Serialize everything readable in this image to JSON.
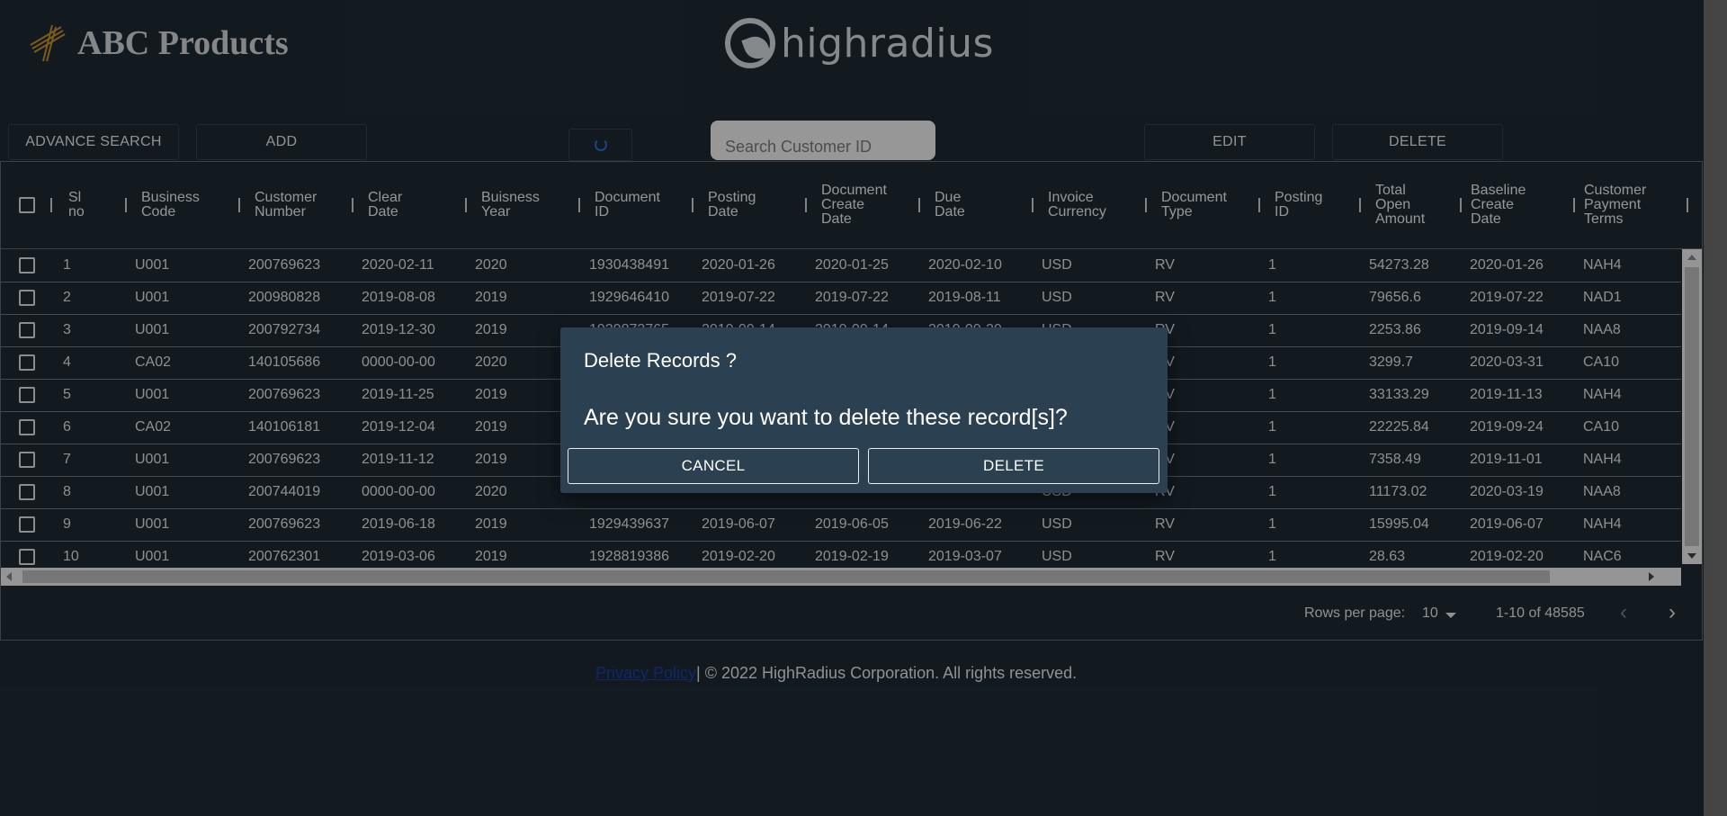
{
  "header": {
    "brand_name": "ABC Products",
    "company_logo_text": "highradius"
  },
  "toolbar": {
    "advance_search": "ADVANCE SEARCH",
    "add": "ADD",
    "refresh_icon": "refresh-icon",
    "search_placeholder": "Search Customer ID",
    "edit": "EDIT",
    "delete": "DELETE"
  },
  "table": {
    "columns": [
      "Sl\nno",
      "Business\nCode",
      "Customer\nNumber",
      "Clear\nDate",
      "Buisness\nYear",
      "Document\nID",
      "Posting\nDate",
      "Document\nCreate\nDate",
      "Due\nDate",
      "Invoice\nCurrency",
      "Document\nType",
      "Posting\nID",
      "Total\nOpen\nAmount",
      "Baseline\nCreate\nDate",
      "Customer\nPayment\nTerms"
    ],
    "rows": [
      [
        "1",
        "U001",
        "200769623",
        "2020-02-11",
        "2020",
        "1930438491",
        "2020-01-26",
        "2020-01-25",
        "2020-02-10",
        "USD",
        "RV",
        "1",
        "54273.28",
        "2020-01-26",
        "NAH4"
      ],
      [
        "2",
        "U001",
        "200980828",
        "2019-08-08",
        "2019",
        "1929646410",
        "2019-07-22",
        "2019-07-22",
        "2019-08-11",
        "USD",
        "RV",
        "1",
        "79656.6",
        "2019-07-22",
        "NAD1"
      ],
      [
        "3",
        "U001",
        "200792734",
        "2019-12-30",
        "2019",
        "1929873765",
        "2019-09-14",
        "2019-09-14",
        "2019-09-29",
        "USD",
        "RV",
        "1",
        "2253.86",
        "2019-09-14",
        "NAA8"
      ],
      [
        "4",
        "CA02",
        "140105686",
        "0000-00-00",
        "2020",
        "",
        "",
        "",
        "",
        "",
        "RV",
        "1",
        "3299.7",
        "2020-03-31",
        "CA10"
      ],
      [
        "5",
        "U001",
        "200769623",
        "2019-11-25",
        "2019",
        "",
        "",
        "",
        "",
        "",
        "RV",
        "1",
        "33133.29",
        "2019-11-13",
        "NAH4"
      ],
      [
        "6",
        "CA02",
        "140106181",
        "2019-12-04",
        "2019",
        "",
        "",
        "",
        "",
        "",
        "RV",
        "1",
        "22225.84",
        "2019-09-24",
        "CA10"
      ],
      [
        "7",
        "U001",
        "200769623",
        "2019-11-12",
        "2019",
        "",
        "",
        "",
        "",
        "",
        "RV",
        "1",
        "7358.49",
        "2019-11-01",
        "NAH4"
      ],
      [
        "8",
        "U001",
        "200744019",
        "0000-00-00",
        "2020",
        "",
        "",
        "",
        "",
        "USD",
        "RV",
        "1",
        "11173.02",
        "2020-03-19",
        "NAA8"
      ],
      [
        "9",
        "U001",
        "200769623",
        "2019-06-18",
        "2019",
        "1929439637",
        "2019-06-07",
        "2019-06-05",
        "2019-06-22",
        "USD",
        "RV",
        "1",
        "15995.04",
        "2019-06-07",
        "NAH4"
      ],
      [
        "10",
        "U001",
        "200762301",
        "2019-03-06",
        "2019",
        "1928819386",
        "2019-02-20",
        "2019-02-19",
        "2019-03-07",
        "USD",
        "RV",
        "1",
        "28.63",
        "2019-02-20",
        "NAC6"
      ]
    ]
  },
  "pagination": {
    "rows_per_page_label": "Rows per page:",
    "rows_per_page_value": "10",
    "range": "1-10 of 48585"
  },
  "footer": {
    "privacy_link": "Privacy Policy",
    "copyright": "| © 2022 HighRadius Corporation. All rights reserved."
  },
  "dialog": {
    "title": "Delete Records ?",
    "message": "Are you sure you want to delete these record[s]?",
    "cancel": "CANCEL",
    "delete": "DELETE"
  }
}
